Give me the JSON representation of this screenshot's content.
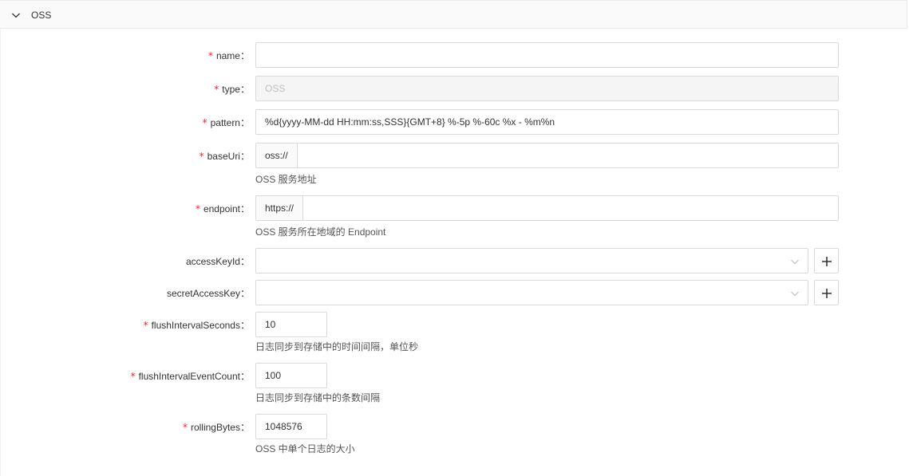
{
  "panel": {
    "title": "OSS"
  },
  "fields": {
    "name": {
      "label": "name",
      "value": ""
    },
    "type": {
      "label": "type",
      "value": "OSS"
    },
    "pattern": {
      "label": "pattern",
      "value": "%d{yyyy-MM-dd HH:mm:ss,SSS}{GMT+8} %-5p %-60c %x - %m%n"
    },
    "baseUri": {
      "label": "baseUri",
      "prefix": "oss://",
      "value": "",
      "help": "OSS 服务地址"
    },
    "endpoint": {
      "label": "endpoint",
      "prefix": "https://",
      "value": "",
      "help": "OSS 服务所在地域的 Endpoint"
    },
    "accessKeyId": {
      "label": "accessKeyId",
      "value": ""
    },
    "secretAccessKey": {
      "label": "secretAccessKey",
      "value": ""
    },
    "flushIntervalSeconds": {
      "label": "flushIntervalSeconds",
      "value": "10",
      "help": "日志同步到存储中的时间间隔，单位秒"
    },
    "flushIntervalEventCount": {
      "label": "flushIntervalEventCount",
      "value": "100",
      "help": "日志同步到存储中的条数间隔"
    },
    "rollingBytes": {
      "label": "rollingBytes",
      "value": "1048576",
      "help": "OSS 中单个日志的大小"
    }
  },
  "colon": "：",
  "required_mark": "*",
  "colors": {
    "required": "#f5222d",
    "border": "#d9d9d9",
    "disabled_bg": "#f5f5f5",
    "addon_bg": "#fafafa"
  }
}
